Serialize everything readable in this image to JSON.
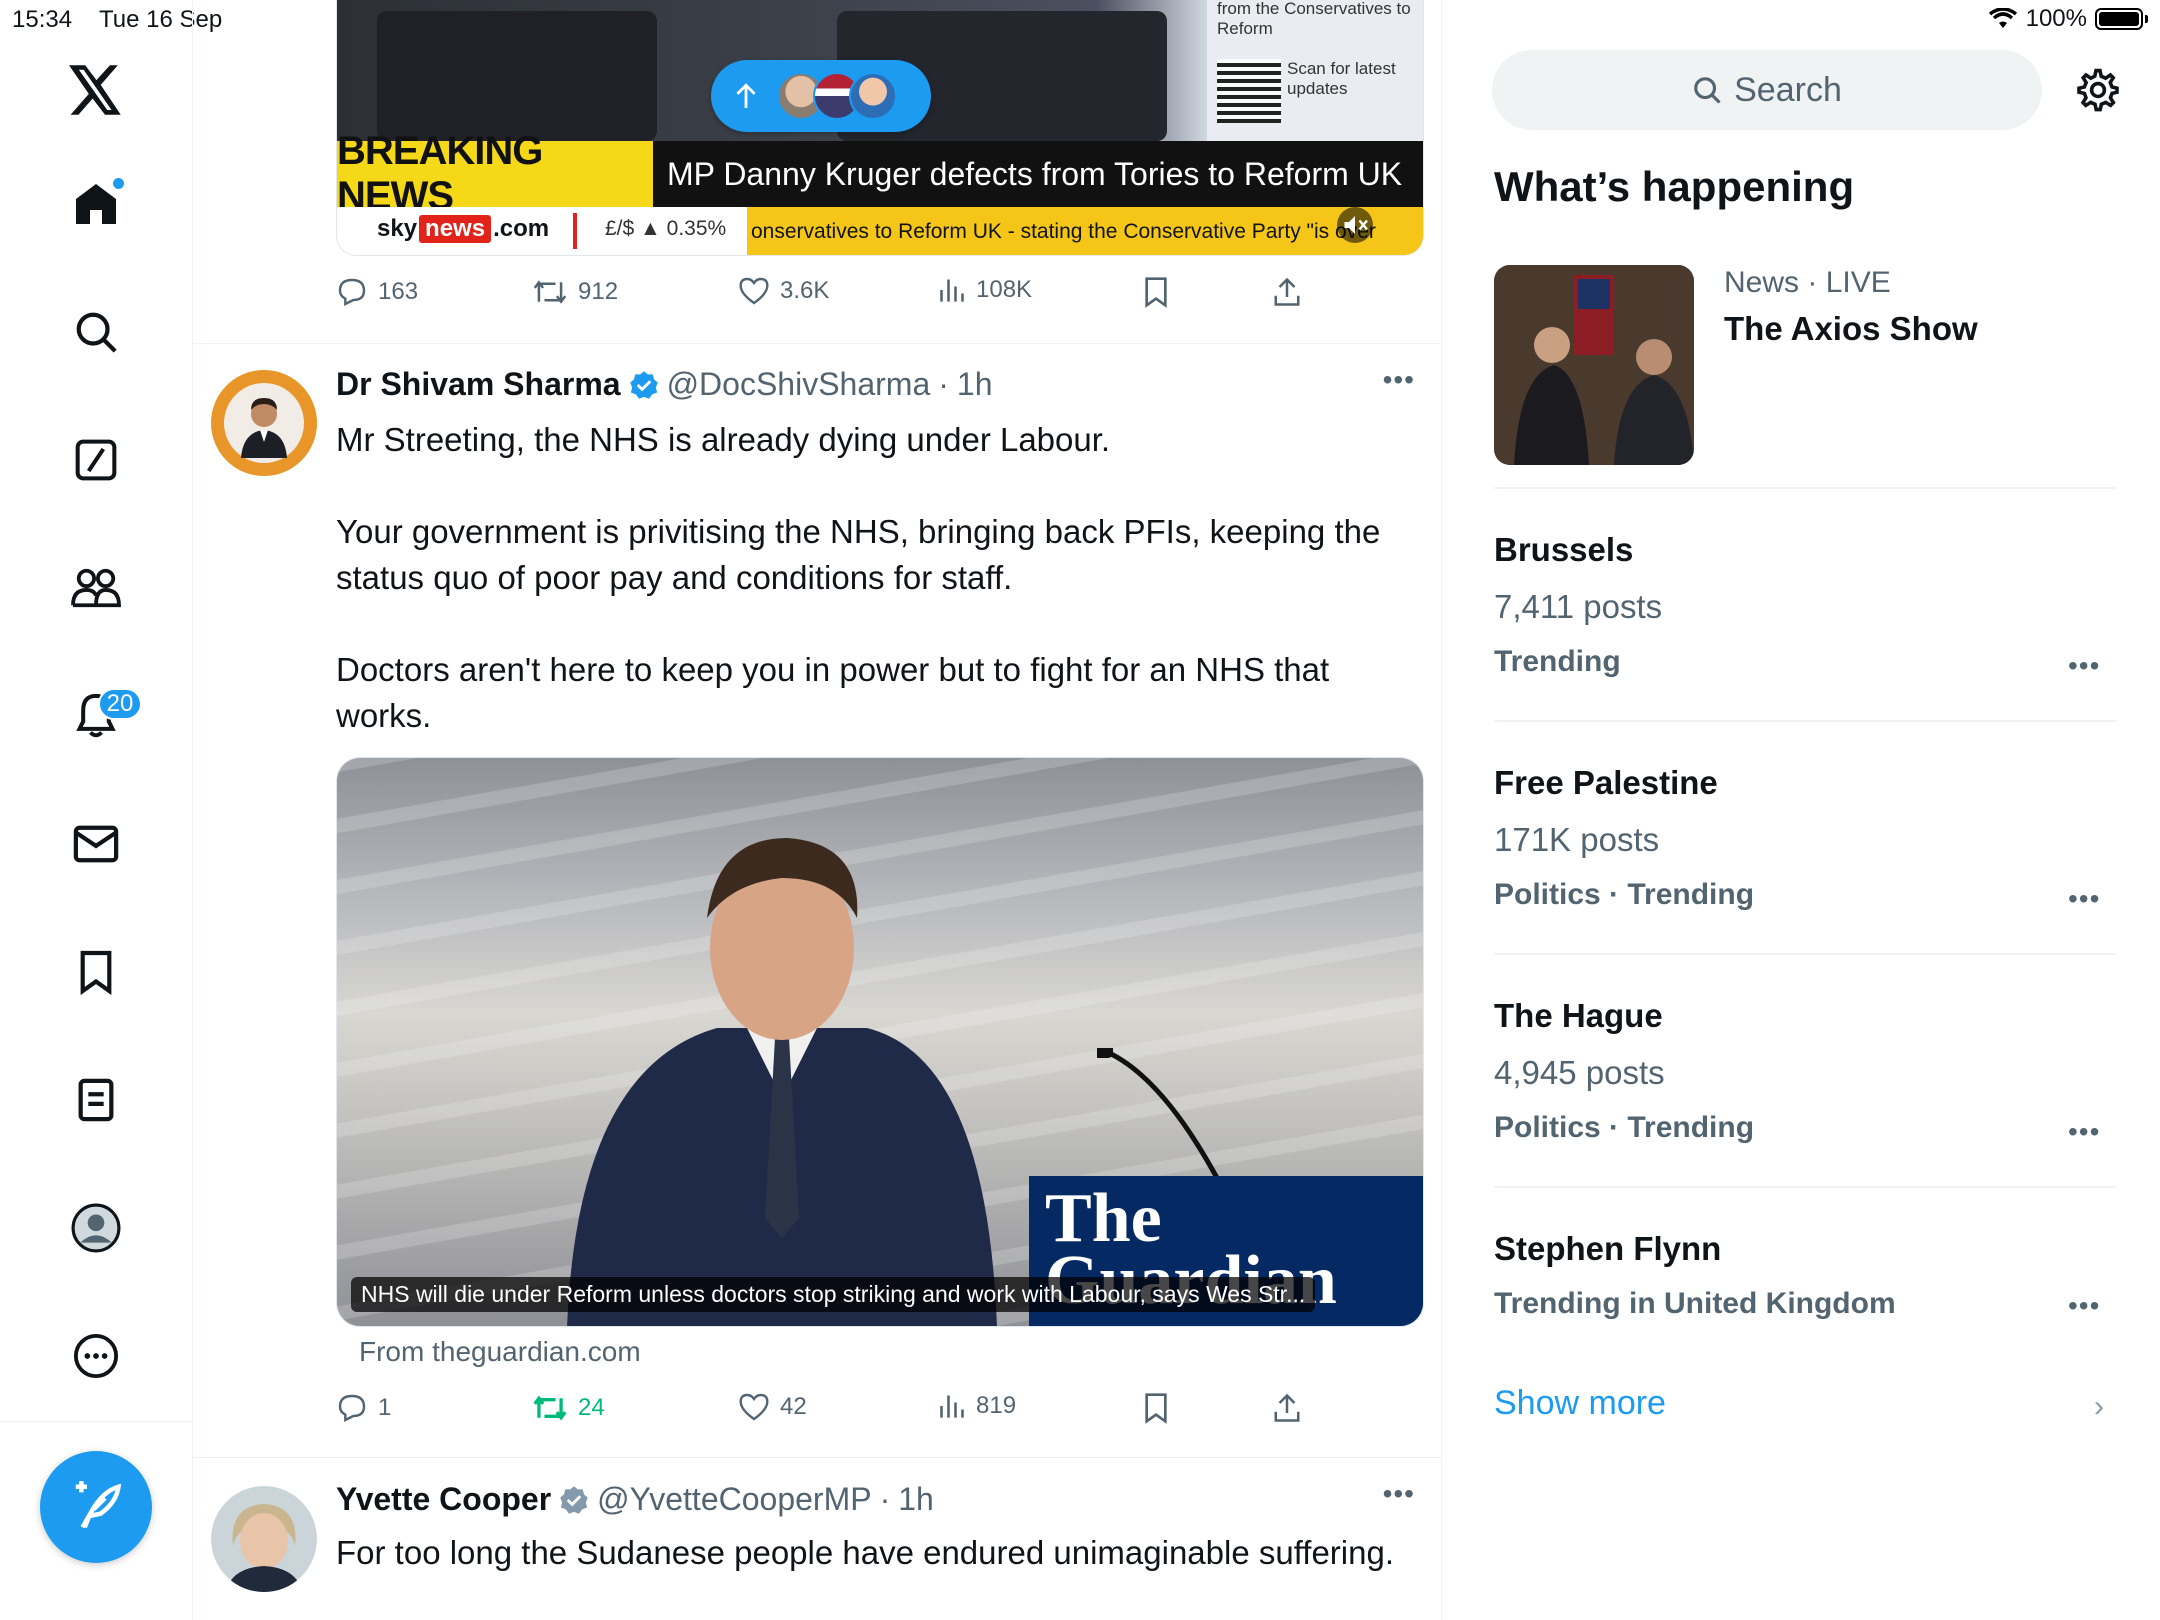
{
  "status_bar": {
    "time": "15:34",
    "date": "Tue 16 Sep",
    "battery": "100%"
  },
  "nav": {
    "notifications_badge": "20"
  },
  "feed": {
    "top_post": {
      "video": {
        "breaking_label": "BREAKING NEWS",
        "headline": "MP Danny Kruger defects from Tories to Reform UK",
        "overlay_text": "from the Conservatives to Reform",
        "scan_text": "Scan for latest updates",
        "sky": "sky",
        "news": "news",
        "dotcom": ".com",
        "fx": "£/$ ▲ 0.35%",
        "crawl": "onservatives to Reform UK - stating the Conservative Party \"is over"
      },
      "stats": {
        "replies": "163",
        "reposts": "912",
        "likes": "3.6K",
        "views": "108K"
      }
    },
    "post2": {
      "name": "Dr Shivam Sharma",
      "handle": "@DocShivSharma",
      "time": "1h",
      "paragraphs": [
        "Mr Streeting, the NHS is already dying under Labour.",
        "Your government is privitising the NHS, bringing back PFIs, keeping the status quo of poor pay and conditions for staff.",
        "Doctors aren't here to keep you in power but to fight for an NHS that works."
      ],
      "card": {
        "publisher": "The Guardian",
        "caption": "NHS will die under Reform unless doctors stop striking and work with Labour, says Wes Str...",
        "from": "From theguardian.com"
      },
      "stats": {
        "replies": "1",
        "reposts": "24",
        "likes": "42",
        "views": "819"
      }
    },
    "post3": {
      "name": "Yvette Cooper",
      "handle": "@YvetteCooperMP",
      "time": "1h",
      "text": "For too long the Sudanese people have endured unimaginable suffering."
    }
  },
  "sidebar": {
    "search_placeholder": "Search",
    "heading": "What’s happening",
    "featured": {
      "category": "News",
      "live": "LIVE",
      "title": "The Axios Show"
    },
    "trends": [
      {
        "title": "Brussels",
        "posts": "7,411 posts",
        "kind": "Trending"
      },
      {
        "title": "Free Palestine",
        "posts": "171K posts",
        "kind": "Politics · Trending"
      },
      {
        "title": "The Hague",
        "posts": "4,945 posts",
        "kind": "Politics · Trending"
      },
      {
        "title": "Stephen Flynn",
        "kind": "Trending in United Kingdom"
      }
    ],
    "show_more": "Show more"
  },
  "colors": {
    "accent": "#1d9bf0",
    "repost_active": "#00ba7c",
    "muted": "#536471"
  }
}
